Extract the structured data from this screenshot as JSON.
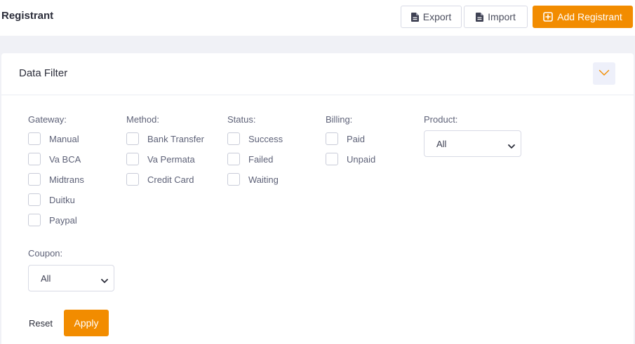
{
  "header": {
    "title": "Registrant",
    "export_label": "Export",
    "import_label": "Import",
    "add_label": "Add Registrant"
  },
  "filter": {
    "title": "Data Filter",
    "gateway": {
      "label": "Gateway:",
      "options": [
        "Manual",
        "Va BCA",
        "Midtrans",
        "Duitku",
        "Paypal"
      ]
    },
    "method": {
      "label": "Method:",
      "options": [
        "Bank Transfer",
        "Va Permata",
        "Credit Card"
      ]
    },
    "status": {
      "label": "Status:",
      "options": [
        "Success",
        "Failed",
        "Waiting"
      ]
    },
    "billing": {
      "label": "Billing:",
      "options": [
        "Paid",
        "Unpaid"
      ]
    },
    "product": {
      "label": "Product:",
      "selected": "All"
    },
    "coupon": {
      "label": "Coupon:",
      "selected": "All"
    },
    "reset_label": "Reset",
    "apply_label": "Apply"
  },
  "colors": {
    "accent": "#f28c00",
    "background": "#f0f1f6"
  },
  "icons": {
    "export": "file-icon",
    "import": "file-icon",
    "add": "plus-square-icon",
    "collapse": "chevron-down-icon"
  }
}
